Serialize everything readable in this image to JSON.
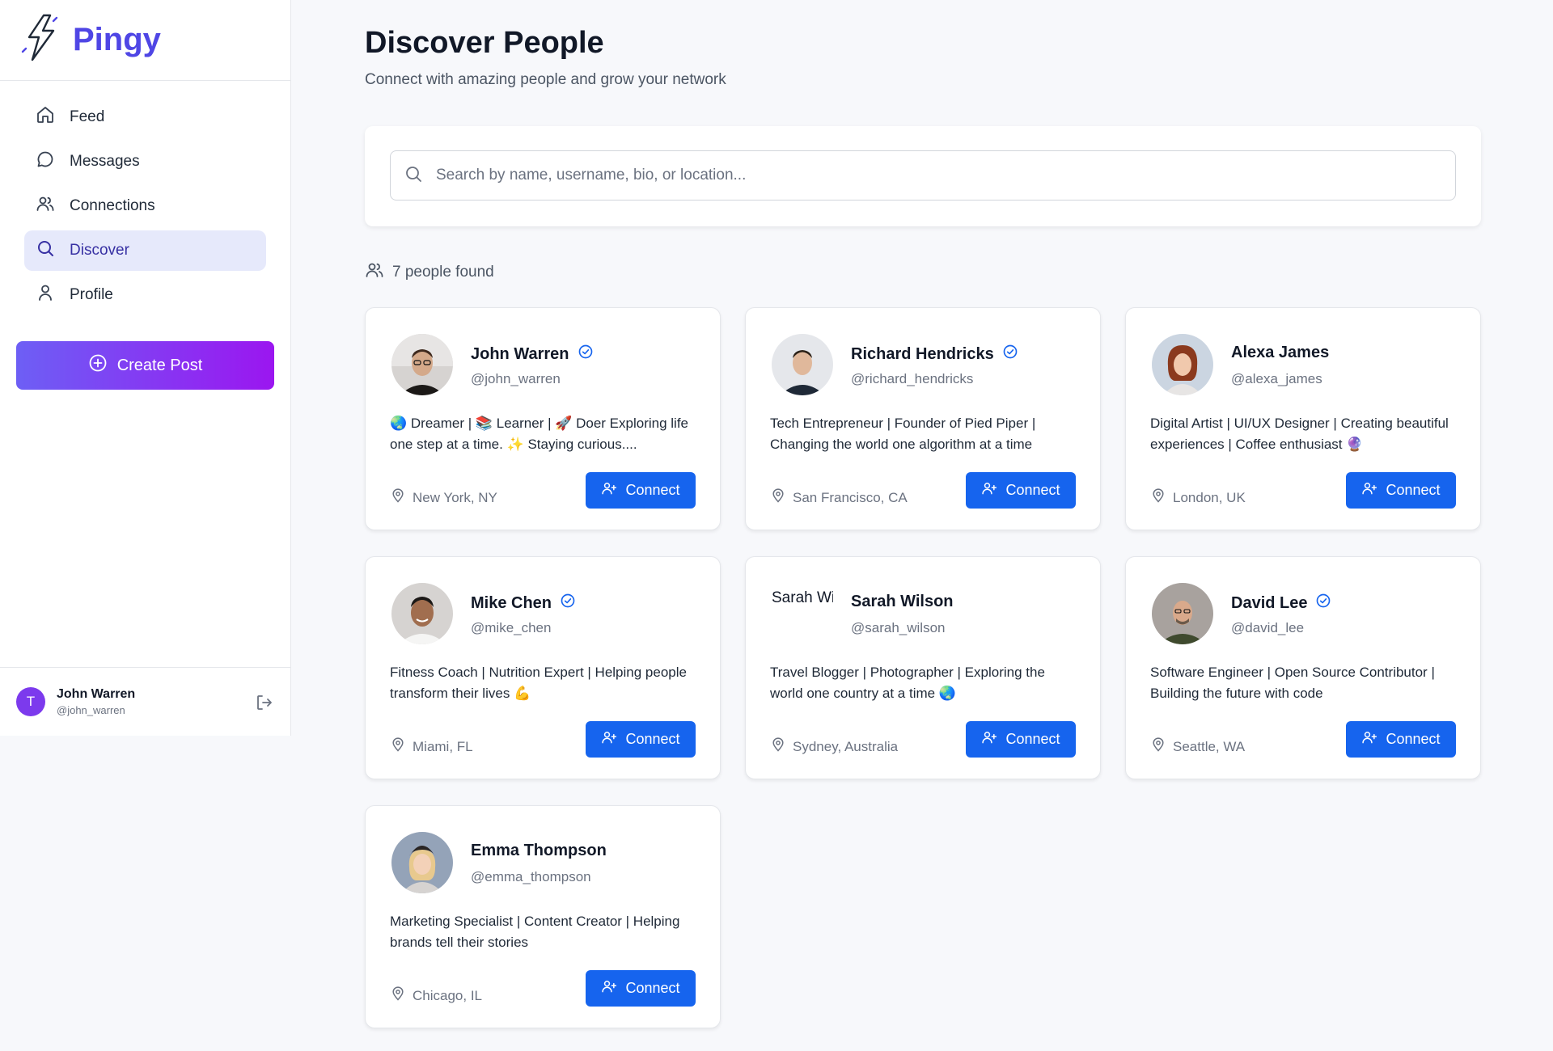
{
  "app": {
    "name": "Pingy"
  },
  "nav": {
    "items": [
      {
        "label": "Feed",
        "icon": "home-icon"
      },
      {
        "label": "Messages",
        "icon": "message-icon"
      },
      {
        "label": "Connections",
        "icon": "users-icon"
      },
      {
        "label": "Discover",
        "icon": "search-icon",
        "active": true
      },
      {
        "label": "Profile",
        "icon": "user-icon"
      }
    ],
    "create_post": "Create Post"
  },
  "current_user": {
    "initial": "T",
    "name": "John Warren",
    "handle": "@john_warren"
  },
  "page": {
    "title": "Discover People",
    "subtitle": "Connect with amazing people and grow your network",
    "search_placeholder": "Search by name, username, bio, or location...",
    "count_label": "7 people found"
  },
  "people": [
    {
      "name": "John Warren",
      "handle": "@john_warren",
      "verified": true,
      "bio": "🌏 Dreamer | 📚 Learner | 🚀 Doer Exploring life one step at a time. ✨ Staying curious....",
      "location": "New York, NY",
      "action": "Connect"
    },
    {
      "name": "Richard Hendricks",
      "handle": "@richard_hendricks",
      "verified": true,
      "bio": "Tech Entrepreneur | Founder of Pied Piper | Changing the world one algorithm at a time",
      "location": "San Francisco, CA",
      "action": "Connect"
    },
    {
      "name": "Alexa James",
      "handle": "@alexa_james",
      "verified": false,
      "bio": "Digital Artist | UI/UX Designer | Creating beautiful experiences | Coffee enthusiast 🔮",
      "location": "London, UK",
      "action": "Connect"
    },
    {
      "name": "Mike Chen",
      "handle": "@mike_chen",
      "verified": true,
      "bio": "Fitness Coach | Nutrition Expert | Helping people transform their lives 💪",
      "location": "Miami, FL",
      "action": "Connect"
    },
    {
      "name": "Sarah Wilson",
      "handle": "@sarah_wilson",
      "verified": false,
      "broken_avatar_alt": "Sarah Wilson",
      "bio": "Travel Blogger | Photographer | Exploring the world one country at a time 🌏",
      "location": "Sydney, Australia",
      "action": "Connect"
    },
    {
      "name": "David Lee",
      "handle": "@david_lee",
      "verified": true,
      "bio": "Software Engineer | Open Source Contributor | Building the future with code",
      "location": "Seattle, WA",
      "action": "Connect"
    },
    {
      "name": "Emma Thompson",
      "handle": "@emma_thompson",
      "verified": false,
      "bio": "Marketing Specialist | Content Creator | Helping brands tell their stories",
      "location": "Chicago, IL",
      "action": "Connect"
    }
  ],
  "colors": {
    "brand": "#4f46e5",
    "primary_button": "#1664ee",
    "active_nav_bg": "#e6e9fb",
    "gradient_start": "#6d5ff5",
    "gradient_end": "#9b16f0"
  }
}
